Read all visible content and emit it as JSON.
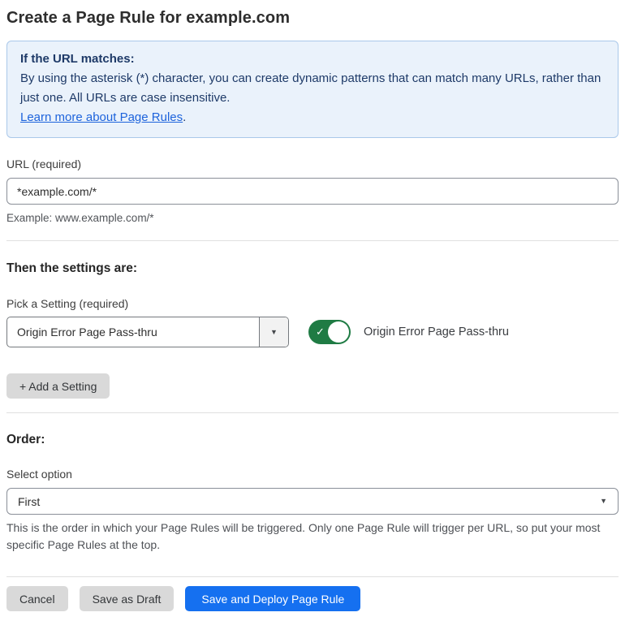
{
  "page": {
    "title": "Create a Page Rule for example.com"
  },
  "info_box": {
    "heading": "If the URL matches:",
    "body": "By using the asterisk (*) character, you can create dynamic patterns that can match many URLs, rather than just one. All URLs are case insensitive.",
    "link_label": "Learn more about Page Rules",
    "link_suffix": "."
  },
  "url_field": {
    "label": "URL (required)",
    "value": "*example.com/*",
    "helper": "Example: www.example.com/*"
  },
  "settings_section": {
    "heading": "Then the settings are:",
    "picker_label": "Pick a Setting (required)",
    "picker_value": "Origin Error Page Pass-thru",
    "toggle_state": "on",
    "toggle_label": "Origin Error Page Pass-thru",
    "add_setting_label": "+ Add a Setting"
  },
  "order_section": {
    "heading": "Order:",
    "select_label": "Select option",
    "select_value": "First",
    "helper": "This is the order in which your Page Rules will be triggered. Only one Page Rule will trigger per URL, so put your most specific Page Rules at the top."
  },
  "footer": {
    "cancel_label": "Cancel",
    "save_draft_label": "Save as Draft",
    "save_deploy_label": "Save and Deploy Page Rule"
  },
  "icons": {
    "chevron_down": "▼",
    "check": "✓"
  },
  "colors": {
    "info_bg": "#eaf2fb",
    "info_border": "#aac8ea",
    "info_text": "#1e3a68",
    "link": "#1d63dc",
    "toggle_on": "#1f7b44",
    "primary_button": "#1570f0",
    "secondary_button": "#d9d9d9"
  }
}
